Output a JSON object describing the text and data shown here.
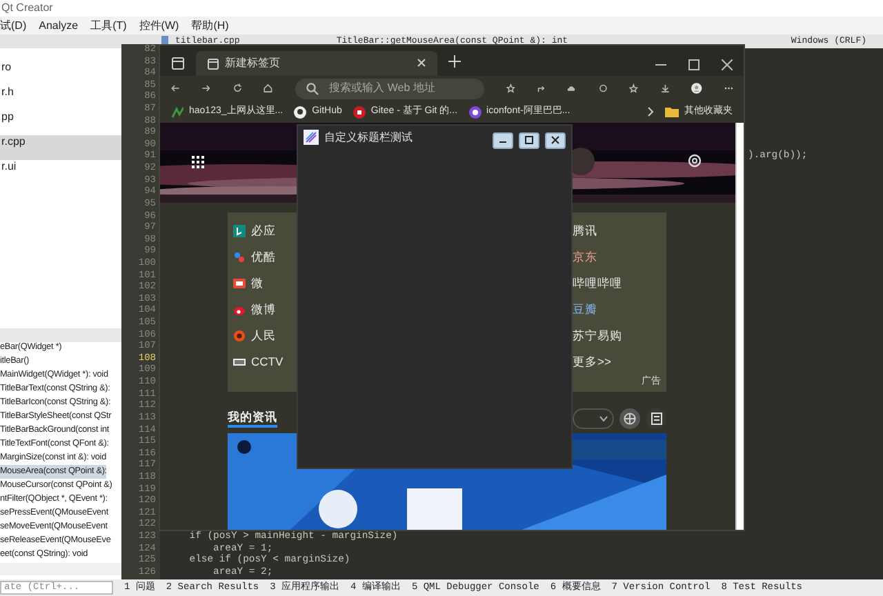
{
  "ide": {
    "title": "Qt Creator",
    "menu": [
      "试(D)",
      "Analyze",
      "工具(T)",
      "控件(W)",
      "帮助(H)"
    ],
    "editor_toolbar": {
      "file": "titlebar.cpp",
      "symbol": "TitleBar::getMouseArea(const QPoint &): int",
      "line_ending": "Windows (CRLF)"
    },
    "project_tree": [
      {
        "label": "ro",
        "selected": false
      },
      {
        "label": "r.h",
        "selected": false
      },
      {
        "label": "pp",
        "selected": false
      },
      {
        "label": "r.cpp",
        "selected": true
      },
      {
        "label": "r.ui",
        "selected": false
      }
    ],
    "outline": [
      {
        "label": "eBar(QWidget *)",
        "selected": false
      },
      {
        "label": "itleBar()",
        "selected": false
      },
      {
        "label": "MainWidget(QWidget *): void",
        "selected": false
      },
      {
        "label": "TitleBarText(const QString &):",
        "selected": false
      },
      {
        "label": "TitleBarIcon(const QString &):",
        "selected": false
      },
      {
        "label": "TitleBarStyleSheet(const QStr",
        "selected": false
      },
      {
        "label": "TitleBarBackGround(const int",
        "selected": false
      },
      {
        "label": "TitleTextFont(const QFont &):",
        "selected": false
      },
      {
        "label": "MarginSize(const int &): void",
        "selected": false
      },
      {
        "label": "MouseArea(const QPoint &):",
        "selected": true
      },
      {
        "label": "MouseCursor(const QPoint &)",
        "selected": false
      },
      {
        "label": "ntFilter(QObject *, QEvent *):",
        "selected": false
      },
      {
        "label": "sePressEvent(QMouseEvent",
        "selected": false
      },
      {
        "label": "seMoveEvent(QMouseEvent",
        "selected": false
      },
      {
        "label": "seReleaseEvent(QMouseEve",
        "selected": false
      },
      {
        "label": "eet(const QString): void",
        "selected": false
      }
    ],
    "editor": {
      "lines": [
        {
          "number": "82",
          "current": false
        },
        {
          "number": "83",
          "current": false
        },
        {
          "number": "84",
          "current": false
        },
        {
          "number": "85",
          "current": false
        },
        {
          "number": "86",
          "current": false
        },
        {
          "number": "87",
          "current": false
        },
        {
          "number": "88",
          "current": false
        },
        {
          "number": "89",
          "current": false
        },
        {
          "number": "90",
          "current": false
        },
        {
          "number": "91",
          "current": false,
          "kind": "tail",
          "code": ").arg(b));"
        },
        {
          "number": "92",
          "current": false
        },
        {
          "number": "93",
          "current": false
        },
        {
          "number": "94",
          "current": false
        },
        {
          "number": "95",
          "current": false
        },
        {
          "number": "96",
          "current": false
        },
        {
          "number": "97",
          "current": false
        },
        {
          "number": "98",
          "current": false
        },
        {
          "number": "99",
          "current": false
        },
        {
          "number": "100",
          "current": false
        },
        {
          "number": "101",
          "current": false
        },
        {
          "number": "102",
          "current": false
        },
        {
          "number": "103",
          "current": false
        },
        {
          "number": "104",
          "current": false
        },
        {
          "number": "105",
          "current": false
        },
        {
          "number": "106",
          "current": false
        },
        {
          "number": "107",
          "current": false
        },
        {
          "number": "108",
          "current": true
        },
        {
          "number": "109",
          "current": false
        },
        {
          "number": "110",
          "current": false
        },
        {
          "number": "111",
          "current": false
        },
        {
          "number": "112",
          "current": false
        },
        {
          "number": "113",
          "current": false
        },
        {
          "number": "114",
          "current": false
        },
        {
          "number": "115",
          "current": false
        },
        {
          "number": "116",
          "current": false
        },
        {
          "number": "117",
          "current": false
        },
        {
          "number": "118",
          "current": false
        },
        {
          "number": "119",
          "current": false
        },
        {
          "number": "120",
          "current": false
        },
        {
          "number": "121",
          "current": false
        },
        {
          "number": "122",
          "current": false
        },
        {
          "number": "123",
          "current": false,
          "kind": "code",
          "code": "    if (posY > mainHeight - marginSize)"
        },
        {
          "number": "124",
          "current": false,
          "kind": "code",
          "code": "        areaY = 1;"
        },
        {
          "number": "125",
          "current": false,
          "kind": "code",
          "code": "    else if (posY < marginSize)"
        },
        {
          "number": "126",
          "current": false,
          "kind": "code",
          "code": "        areaY = 2;"
        }
      ]
    },
    "locator": {
      "placeholder": "ate (Ctrl+..."
    },
    "output_tabs": [
      "1 问题",
      "2 Search Results",
      "3 应用程序输出",
      "4 编译输出",
      "5 QML Debugger Console",
      "6 概要信息",
      "7 Version Control",
      "8 Test Results"
    ]
  },
  "browser": {
    "tab": {
      "title": "新建标签页"
    },
    "address": {
      "placeholder": "搜索或输入 Web 地址"
    },
    "favorites": [
      {
        "label": "hao123_上网从这里...",
        "kind": "hao"
      },
      {
        "label": "GitHub",
        "kind": "github"
      },
      {
        "label": "Gitee - 基于 Git 的...",
        "kind": "gitee"
      },
      {
        "label": "iconfont-阿里巴巴...",
        "kind": "iconfont"
      }
    ],
    "other_favorites": "其他收藏夹",
    "links_left": [
      {
        "label": "必应",
        "kind": "bing"
      },
      {
        "label": "优酷",
        "kind": "youku"
      },
      {
        "label": "微",
        "kind": "video"
      },
      {
        "label": "微博",
        "kind": "weibo"
      },
      {
        "label": "人民",
        "kind": "people"
      },
      {
        "label": "CCTV",
        "kind": "tv"
      }
    ],
    "links_right": [
      {
        "label": "腾讯",
        "color": "#e8e8e8"
      },
      {
        "label": "京东",
        "color": "#e8a090"
      },
      {
        "label": "哔哩哔哩",
        "color": "#e8e8e8"
      },
      {
        "label": "豆瓣",
        "color": "#7fb2e5"
      },
      {
        "label": "苏宁易购",
        "color": "#e8e8e8"
      },
      {
        "label": "更多>>",
        "color": "#e8e8e8"
      }
    ],
    "ad_label": "广告",
    "feed_tabs": [
      {
        "label": "我的资讯",
        "selected": true
      }
    ]
  },
  "dialog": {
    "title": "自定义标题栏测试"
  }
}
